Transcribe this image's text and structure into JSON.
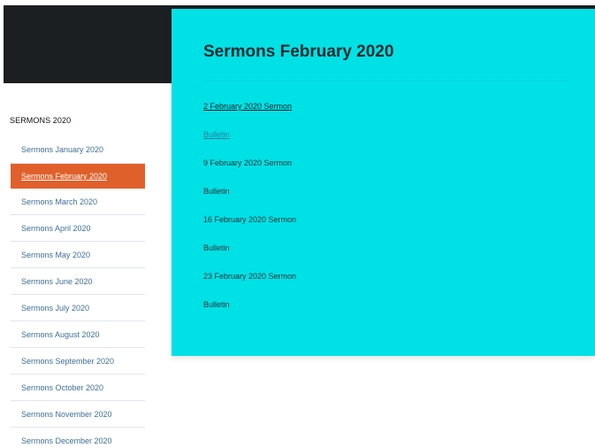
{
  "sidebar": {
    "title": "SERMONS 2020",
    "items": [
      {
        "label": "Sermons January 2020"
      },
      {
        "label": "Sermons February 2020"
      },
      {
        "label": "Sermons March 2020"
      },
      {
        "label": "Sermons April 2020"
      },
      {
        "label": "Sermons May 2020"
      },
      {
        "label": "Sermons June 2020"
      },
      {
        "label": "Sermons July 2020"
      },
      {
        "label": "Sermons August 2020"
      },
      {
        "label": "Sermons September 2020"
      },
      {
        "label": "Sermons October 2020"
      },
      {
        "label": "Sermons November 2020"
      },
      {
        "label": "Sermons December 2020"
      }
    ],
    "active_index": 1
  },
  "main": {
    "title": "Sermons February 2020",
    "entries": [
      {
        "label": "2 February 2020 Sermon"
      },
      {
        "label": "Bulletin"
      },
      {
        "label": "9 February 2020 Sermon"
      },
      {
        "label": "Bulletin"
      },
      {
        "label": "16 February 2020 Sermon"
      },
      {
        "label": "Bulletin"
      },
      {
        "label": "23 February 2020 Sermon"
      },
      {
        "label": "Bulletin"
      }
    ]
  },
  "colors": {
    "header_dark": "#1b1f22",
    "content_bg": "#00e1e6",
    "active_item_bg": "#e0602b",
    "sidebar_link": "#3d6f94"
  }
}
